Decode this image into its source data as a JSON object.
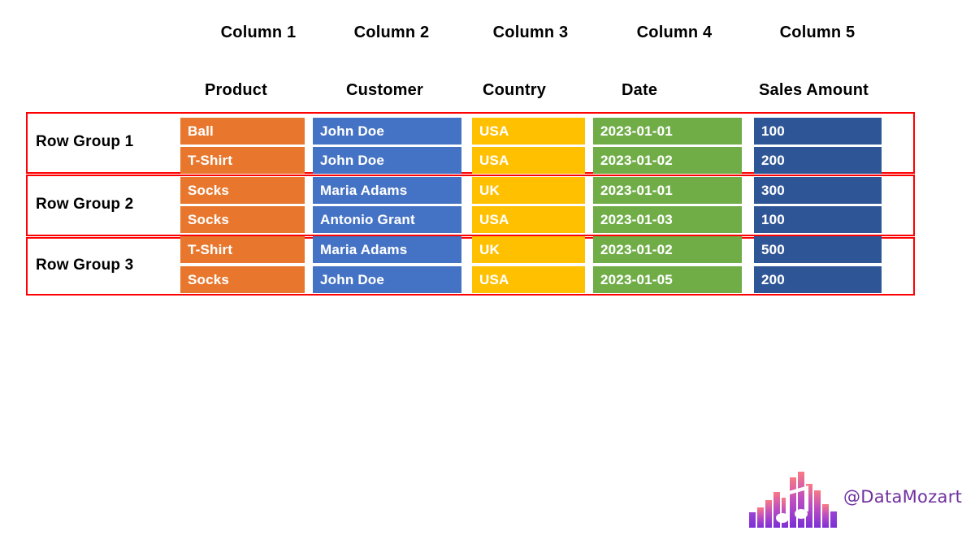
{
  "table": {
    "column_numbers": [
      "Column 1",
      "Column 2",
      "Column 3",
      "Column 4",
      "Column 5"
    ],
    "field_names": [
      "Product",
      "Customer",
      "Country",
      "Date",
      "Sales Amount"
    ],
    "column_colors": [
      "#E8762C",
      "#4472C4",
      "#FFC000",
      "#70AD47",
      "#2E5596"
    ],
    "row_group_border_color": "#FF0000",
    "row_groups": [
      {
        "label": "Row Group 1",
        "rows": [
          {
            "product": "Ball",
            "customer": "John Doe",
            "country": "USA",
            "date": "2023-01-01",
            "sales_amount": "100"
          },
          {
            "product": "T-Shirt",
            "customer": "John Doe",
            "country": "USA",
            "date": "2023-01-02",
            "sales_amount": "200"
          }
        ]
      },
      {
        "label": "Row Group 2",
        "rows": [
          {
            "product": "Socks",
            "customer": "Maria Adams",
            "country": "UK",
            "date": "2023-01-01",
            "sales_amount": "300"
          },
          {
            "product": "Socks",
            "customer": "Antonio Grant",
            "country": "USA",
            "date": "2023-01-03",
            "sales_amount": "100"
          }
        ]
      },
      {
        "label": "Row Group 3",
        "rows": [
          {
            "product": "T-Shirt",
            "customer": "Maria Adams",
            "country": "UK",
            "date": "2023-01-02",
            "sales_amount": "500"
          },
          {
            "product": "Socks",
            "customer": "John Doe",
            "country": "USA",
            "date": "2023-01-05",
            "sales_amount": "200"
          }
        ]
      }
    ]
  },
  "watermark": {
    "brand": "@DataMozart",
    "brand_color": "#7030A0",
    "logo_name": "equalizer-music-note-logo",
    "logo_gradient_top": "#F8737F",
    "logo_gradient_bottom": "#7B2FD6"
  }
}
